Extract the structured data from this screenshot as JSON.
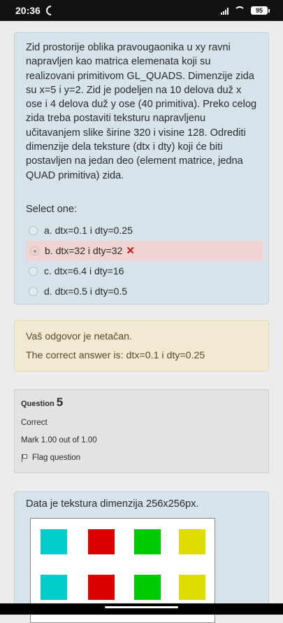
{
  "status_bar": {
    "time": "20:36",
    "battery": "95"
  },
  "question": {
    "text": "Zid prostorije oblika pravougaonika u xy ravni napravljen kao matrica elemenata koji su realizovani primitivom GL_QUADS. Dimenzije zida su x=5 i y=2. Zid je podeljen na 10 delova duž x ose i 4 delova duž y ose (40 primitiva). Preko celog zida treba postaviti teksturu napravljenu učitavanjem slike širine 320 i visine 128. Odrediti dimenzije dela teksture (dtx i dty) koji će biti postavljen na jedan deo (element matrice, jedna QUAD primitiva) zida.",
    "select_label": "Select one:",
    "options": [
      {
        "label": "a. dtx=0.1 i dty=0.25"
      },
      {
        "label": "b. dtx=32 i dty=32"
      },
      {
        "label": "c. dtx=6.4 i dty=16"
      },
      {
        "label": "d. dtx=0.5 i dty=0.5"
      }
    ]
  },
  "feedback": {
    "result": "Vaš odgovor je netačan.",
    "correct_answer": "The correct answer is: dtx=0.1 i dty=0.25"
  },
  "question_info": {
    "label": "Question",
    "number": "5",
    "state": "Correct",
    "mark": "Mark 1.00 out of 1.00",
    "flag": "Flag question"
  },
  "next_question": {
    "text": "Data je tekstura dimenzija 256x256px."
  },
  "texture_colors": {
    "cyan": "#00cccc",
    "red": "#dd0000",
    "green": "#00cc00",
    "yellow": "#dddd00"
  }
}
